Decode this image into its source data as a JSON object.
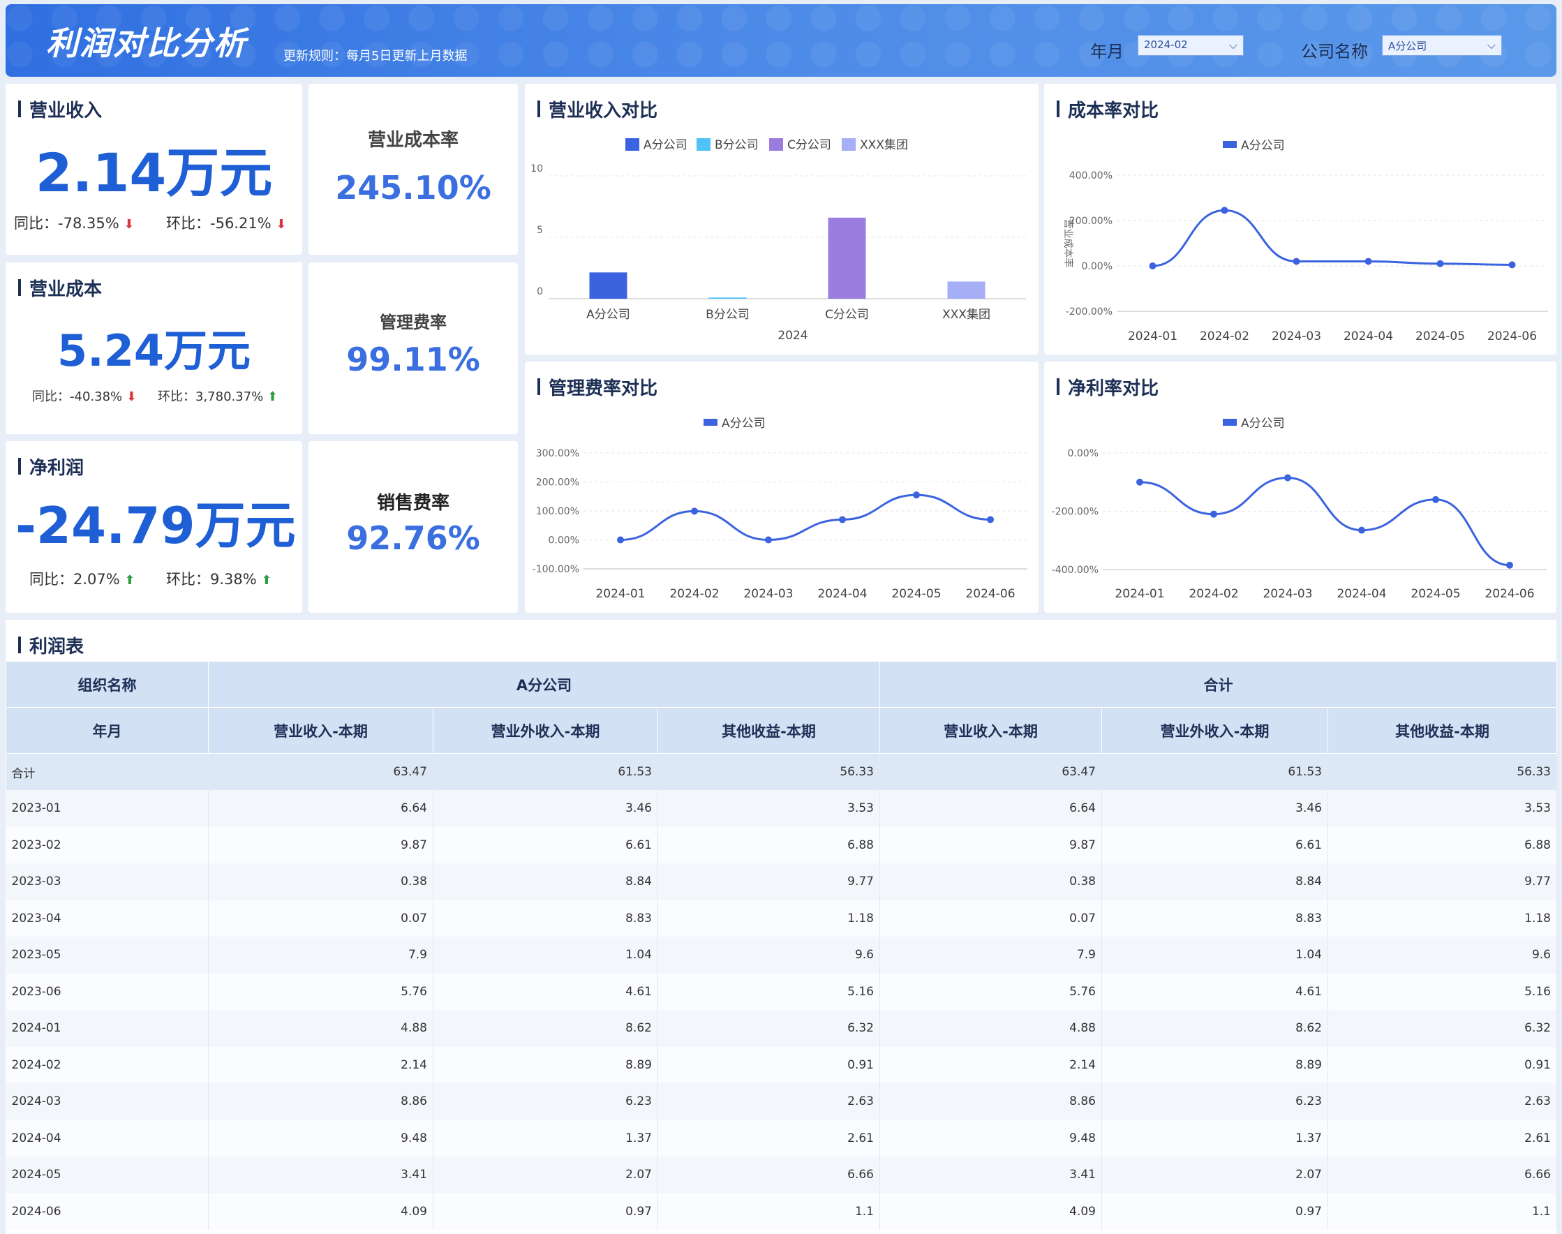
{
  "header": {
    "title": "利润对比分析",
    "rule": "更新规则：每月5日更新上月数据",
    "filter_month_label": "年月",
    "filter_month_value": "2024-02",
    "filter_company_label": "公司名称",
    "filter_company_value": "A分公司"
  },
  "kpi": {
    "revenue": {
      "title": "营业收入",
      "value": "2.14万元",
      "yoy": "同比：-78.35%",
      "mom": "环比：-56.21%"
    },
    "cost": {
      "title": "营业成本",
      "value": "5.24万元",
      "yoy": "同比：-40.38%",
      "mom": "环比：3,780.37%"
    },
    "profit": {
      "title": "净利润",
      "value": "-24.79万元",
      "yoy": "同比：2.07%",
      "mom": "环比：9.38%"
    }
  },
  "rates": {
    "cost_rate": {
      "title": "营业成本率",
      "value": "245.10%"
    },
    "mgmt_rate": {
      "title": "管理费率",
      "value": "99.11%"
    },
    "sales_rate": {
      "title": "销售费率",
      "value": "92.76%"
    }
  },
  "colors": {
    "primary": "#3b63e0",
    "b": "#4fc3f7",
    "c": "#9b7de0",
    "xxx": "#a6aef5",
    "down": "#d9363e",
    "up": "#2a9d3f"
  },
  "chart_data": [
    {
      "id": "revenue_compare",
      "type": "bar",
      "title": "营业收入对比",
      "categories": [
        "A分公司",
        "B分公司",
        "C分公司",
        "XXX集团"
      ],
      "series": [
        {
          "name": "2024",
          "values": [
            2.14,
            0.1,
            6.6,
            1.4
          ]
        }
      ],
      "legend": [
        "A分公司",
        "B分公司",
        "C分公司",
        "XXX集团"
      ],
      "xlabel": "2024",
      "ylim": [
        0,
        10
      ],
      "yticks": [
        "10",
        "5",
        "0"
      ]
    },
    {
      "id": "cost_rate_compare",
      "type": "line",
      "title": "成本率对比",
      "x": [
        "2024-01",
        "2024-02",
        "2024-03",
        "2024-04",
        "2024-05",
        "2024-06"
      ],
      "series": [
        {
          "name": "A分公司",
          "values": [
            0,
            245.1,
            20,
            20,
            10,
            5
          ]
        }
      ],
      "ylabel": "营业成本率",
      "ylim": [
        -200,
        400
      ],
      "yticks": [
        "400.00%",
        "200.00%",
        "0.00%",
        "-200.00%"
      ]
    },
    {
      "id": "mgmt_rate_compare",
      "type": "line",
      "title": "管理费率对比",
      "x": [
        "2024-01",
        "2024-02",
        "2024-03",
        "2024-04",
        "2024-05",
        "2024-06"
      ],
      "series": [
        {
          "name": "A分公司",
          "values": [
            0,
            99.11,
            0,
            70,
            155,
            70
          ]
        }
      ],
      "ylim": [
        -100,
        300
      ],
      "yticks": [
        "300.00%",
        "200.00%",
        "100.00%",
        "0.00%",
        "-100.00%"
      ]
    },
    {
      "id": "net_rate_compare",
      "type": "line",
      "title": "净利率对比",
      "x": [
        "2024-01",
        "2024-02",
        "2024-03",
        "2024-04",
        "2024-05",
        "2024-06"
      ],
      "series": [
        {
          "name": "A分公司",
          "values": [
            -100,
            -210,
            -85,
            -265,
            -160,
            -385
          ]
        }
      ],
      "ylim": [
        -400,
        0
      ],
      "yticks": [
        "0.00%",
        "-200.00%",
        "-400.00%"
      ]
    }
  ],
  "table": {
    "title": "利润表",
    "h_org": "组织名称",
    "h_group1": "A分公司",
    "h_group2": "合计",
    "h_month": "年月",
    "cols": [
      "营业收入-本期",
      "营业外收入-本期",
      "其他收益-本期",
      "营业收入-本期",
      "营业外收入-本期",
      "其他收益-本期"
    ],
    "rows": [
      [
        "合计",
        "63.47",
        "61.53",
        "56.33",
        "63.47",
        "61.53",
        "56.33"
      ],
      [
        "2023-01",
        "6.64",
        "3.46",
        "3.53",
        "6.64",
        "3.46",
        "3.53"
      ],
      [
        "2023-02",
        "9.87",
        "6.61",
        "6.88",
        "9.87",
        "6.61",
        "6.88"
      ],
      [
        "2023-03",
        "0.38",
        "8.84",
        "9.77",
        "0.38",
        "8.84",
        "9.77"
      ],
      [
        "2023-04",
        "0.07",
        "8.83",
        "1.18",
        "0.07",
        "8.83",
        "1.18"
      ],
      [
        "2023-05",
        "7.9",
        "1.04",
        "9.6",
        "7.9",
        "1.04",
        "9.6"
      ],
      [
        "2023-06",
        "5.76",
        "4.61",
        "5.16",
        "5.76",
        "4.61",
        "5.16"
      ],
      [
        "2024-01",
        "4.88",
        "8.62",
        "6.32",
        "4.88",
        "8.62",
        "6.32"
      ],
      [
        "2024-02",
        "2.14",
        "8.89",
        "0.91",
        "2.14",
        "8.89",
        "0.91"
      ],
      [
        "2024-03",
        "8.86",
        "6.23",
        "2.63",
        "8.86",
        "6.23",
        "2.63"
      ],
      [
        "2024-04",
        "9.48",
        "1.37",
        "2.61",
        "9.48",
        "1.37",
        "2.61"
      ],
      [
        "2024-05",
        "3.41",
        "2.07",
        "6.66",
        "3.41",
        "2.07",
        "6.66"
      ],
      [
        "2024-06",
        "4.09",
        "0.97",
        "1.1",
        "4.09",
        "0.97",
        "1.1"
      ]
    ]
  }
}
